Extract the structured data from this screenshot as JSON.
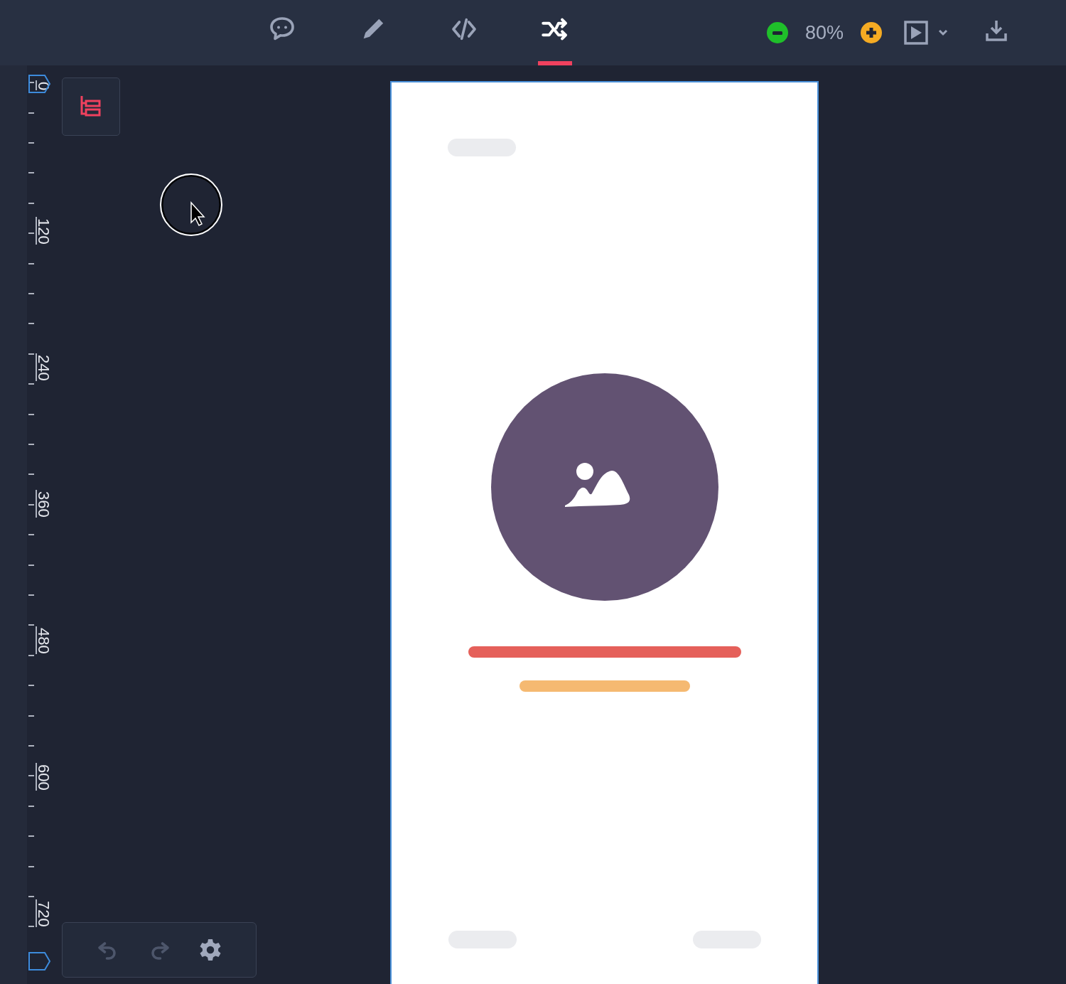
{
  "toolbar": {
    "tabs": [
      {
        "kind": "comment",
        "selected": false
      },
      {
        "kind": "pencil",
        "selected": false
      },
      {
        "kind": "code",
        "selected": false
      },
      {
        "kind": "shuffle",
        "selected": true
      }
    ],
    "zoom": "80%"
  },
  "ruler": {
    "labels": [
      "0",
      "120",
      "240",
      "360",
      "480",
      "600",
      "720"
    ]
  },
  "history": [
    {
      "kind": "undo",
      "disabled": true
    },
    {
      "kind": "redo",
      "disabled": true
    },
    {
      "kind": "settings",
      "disabled": false
    }
  ]
}
